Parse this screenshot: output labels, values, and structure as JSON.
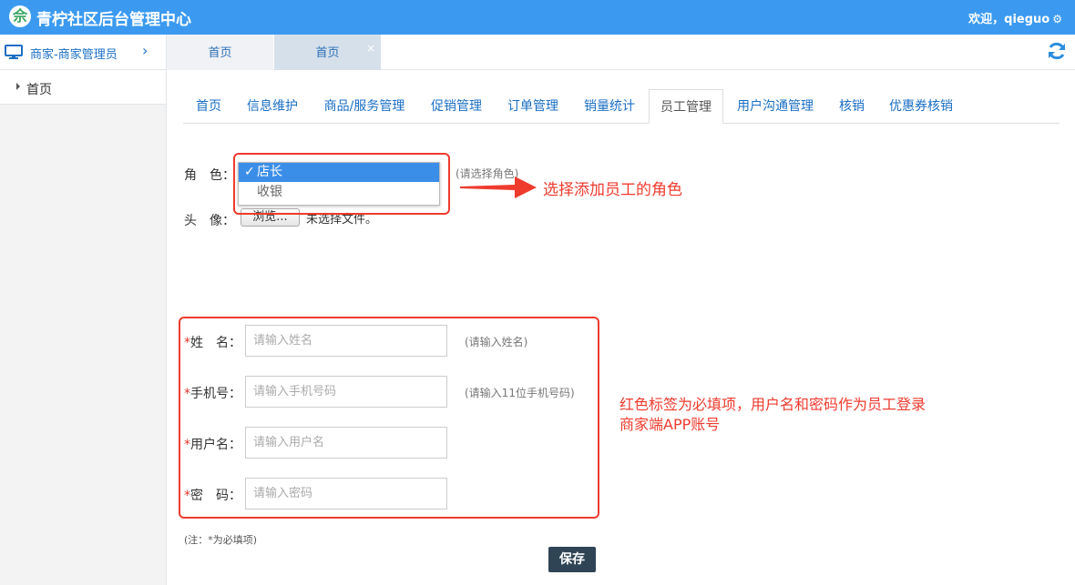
{
  "header": {
    "logo_glyph": "佘",
    "title": "青柠社区后台管理中心",
    "welcome": "欢迎，qieguo",
    "settings_icon": "gear-icon",
    "bg_color": "#3b9af0"
  },
  "subbar": {
    "role_label": "商家-商家管理员",
    "tabs": [
      {
        "label": "首页"
      },
      {
        "label": "首页",
        "close": "×"
      }
    ],
    "refresh_icon": "refresh-icon"
  },
  "sidebar": {
    "items": [
      {
        "label": "首页"
      }
    ]
  },
  "module_tabs": [
    {
      "label": "首页"
    },
    {
      "label": "信息维护"
    },
    {
      "label": "商品/服务管理"
    },
    {
      "label": "促销管理"
    },
    {
      "label": "订单管理"
    },
    {
      "label": "销量统计"
    },
    {
      "label": "员工管理",
      "active": true
    },
    {
      "label": "用户沟通管理"
    },
    {
      "label": "核销"
    },
    {
      "label": "优惠券核销"
    }
  ],
  "form": {
    "role": {
      "label": "角　色：",
      "options": [
        {
          "label": "店长",
          "selected": true,
          "check": "✓"
        },
        {
          "label": "收银"
        }
      ],
      "hint": "(请选择角色)"
    },
    "avatar": {
      "label": "头　像：",
      "button": "浏览...",
      "no_file": "未选择文件。"
    },
    "name": {
      "required": "*",
      "label": "姓　名：",
      "placeholder": "请输入姓名",
      "hint": "(请输入姓名)"
    },
    "phone": {
      "required": "*",
      "label": "手机号：",
      "placeholder": "请输入手机号码",
      "hint": "(请输入11位手机号码)"
    },
    "username": {
      "required": "*",
      "label": "用户名：",
      "placeholder": "请输入用户名"
    },
    "password": {
      "required": "*",
      "label": "密　码：",
      "placeholder": "请输入密码"
    },
    "note": "(注：*为必填项)",
    "save": "保存"
  },
  "annotations": {
    "role_note": "选择添加员工的角色",
    "required_note_line1": "红色标签为必填项，用户名和密码作为员工登录",
    "required_note_line2": "商家端APP账号",
    "color": "#ee3b2e"
  }
}
